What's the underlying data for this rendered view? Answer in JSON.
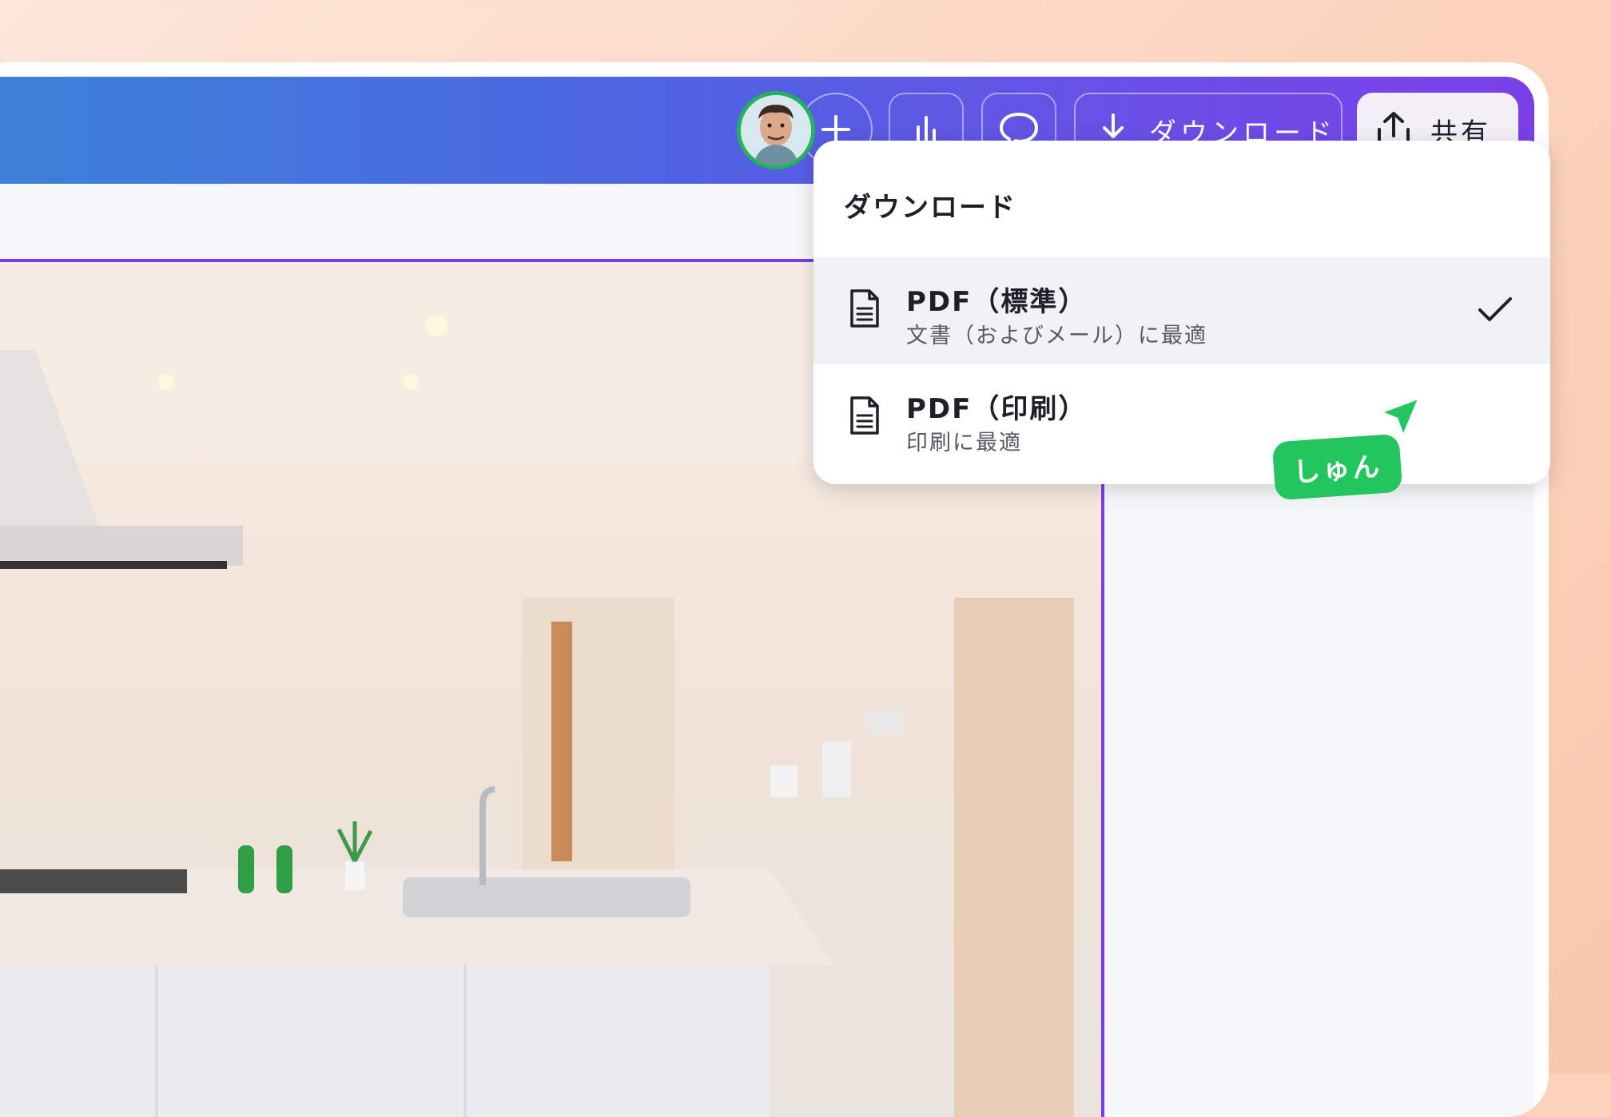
{
  "toolbar": {
    "download_label": "ダウンロード",
    "share_label": "共有"
  },
  "download_panel": {
    "title": "ダウンロード",
    "options": [
      {
        "title": "PDF（標準）",
        "subtitle": "文書（およびメール）に最適",
        "selected": true
      },
      {
        "title": "PDF（印刷）",
        "subtitle": "印刷に最適",
        "selected": false
      }
    ]
  },
  "collaborator": {
    "name": "しゅん",
    "color": "#22c55e"
  },
  "colors": {
    "accent": "#7c3aed",
    "toolbar_start": "#3b82d8",
    "toolbar_end": "#7b3fe8"
  },
  "icons": {
    "plus": "plus-icon",
    "chart": "bar-chart-icon",
    "comment": "comment-icon",
    "download": "download-icon",
    "share": "share-upload-icon",
    "file": "document-icon",
    "check": "checkmark-icon",
    "cursor": "cursor-arrow-icon"
  }
}
